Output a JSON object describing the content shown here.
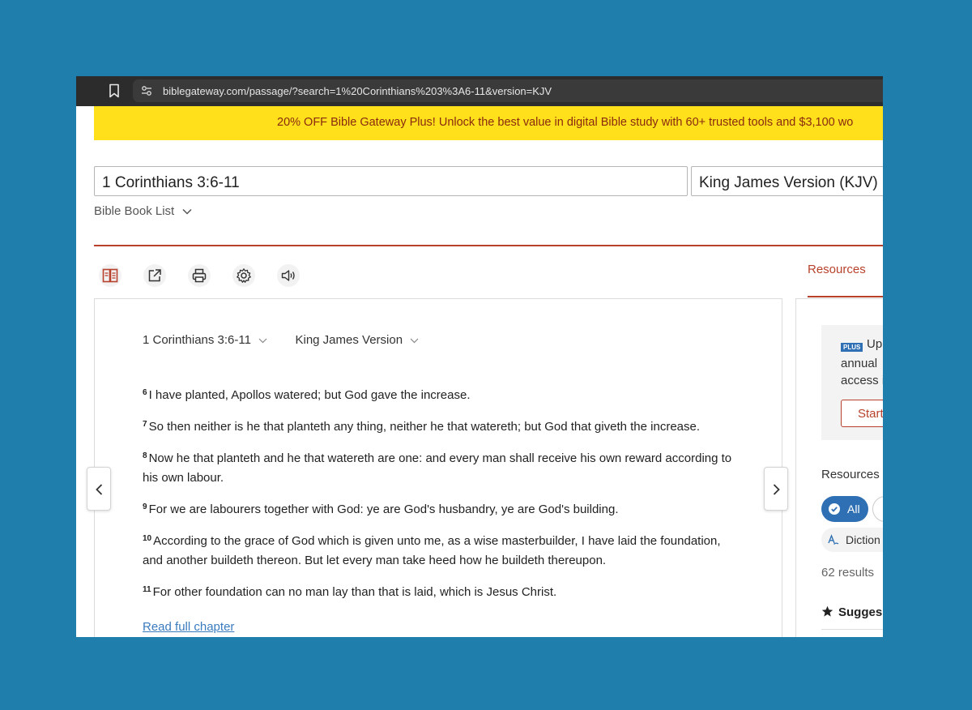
{
  "browser": {
    "url": "biblegateway.com/passage/?search=1%20Corinthians%203%3A6-11&version=KJV"
  },
  "promo": {
    "text": "20% OFF Bible Gateway Plus! Unlock the best value in digital Bible study with 60+ trusted tools and $3,100 wo"
  },
  "search": {
    "passage_value": "1 Corinthians 3:6-11",
    "version_value": "King James Version (KJV)",
    "book_list_label": "Bible Book List"
  },
  "toolbar": {
    "icons": [
      "parallel-view-icon",
      "share-icon",
      "print-icon",
      "settings-icon",
      "audio-icon"
    ]
  },
  "tabs": {
    "resources": "Resources"
  },
  "passage": {
    "reference": "1 Corinthians 3:6-11",
    "version": "King James Version",
    "verses": [
      {
        "num": "6",
        "text": "I have planted, Apollos watered; but God gave the increase."
      },
      {
        "num": "7",
        "text": "So then neither is he that planteth any thing, neither he that watereth; but God that giveth the increase."
      },
      {
        "num": "8",
        "text": "Now he that planteth and he that watereth are one: and every man shall receive his own reward according to his own labour."
      },
      {
        "num": "9",
        "text": "For we are labourers together with God: ye are God's husbandry, ye are God's building."
      },
      {
        "num": "10",
        "text": "According to the grace of God which is given unto me, as a wise masterbuilder, I have laid the foundation, and another buildeth thereon. But let every man take heed how he buildeth thereupon."
      },
      {
        "num": "11",
        "text": "For other foundation can no man lay than that is laid, which is Jesus Christ."
      }
    ],
    "read_full_chapter": "Read full chapter"
  },
  "sidebar": {
    "plus_badge": "PLUS",
    "upgrade_text": "Up",
    "annual_text": "annual",
    "access_text": "access i",
    "start_button": "Start",
    "resources_for": "Resources f",
    "filter_all": "All",
    "filter_dictionary": "Diction",
    "results_count": "62 results",
    "suggested": "Sugges"
  },
  "colors": {
    "page_background": "#1f7eac",
    "promo_background": "#ffe01b",
    "brand_red": "#b8412c",
    "link_blue": "#3a7bbf",
    "pill_blue": "#2f6fb3"
  }
}
